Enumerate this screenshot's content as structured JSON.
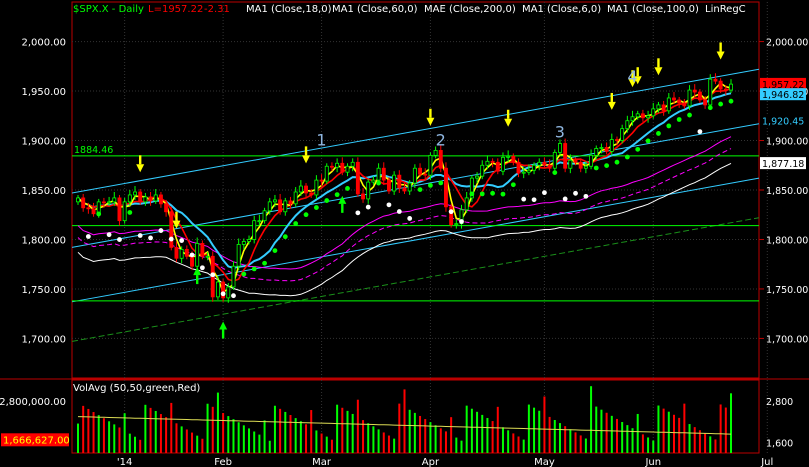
{
  "header": {
    "symbol": "$SPX.X - Daily",
    "last": "L=1957.22",
    "change": "-2.31",
    "studies": [
      "MA1 (Close,18,0)",
      "MA1 (Close,60,0)",
      "MAE (Close,200,0)",
      "MA1 (Close,6,0)",
      "MA1 (Close,100,0)",
      "LinRegC"
    ]
  },
  "colors": {
    "up": "#00ff00",
    "down": "#ff0000",
    "ma6": "#ffff00",
    "ma18": "#ff0000",
    "ma60": "#33ccff",
    "ma100": "#ff00ff",
    "mae200": "#ffffff",
    "channel": "#33ccff",
    "support": "#00ff00",
    "arrow_down": "#ffff00",
    "arrow_up": "#00ff00"
  },
  "chart_data": [
    {
      "type": "candlestick",
      "ylim": [
        1660,
        2040
      ],
      "y_ticks": [
        {
          "value": 2000,
          "label": "2,000.00"
        },
        {
          "value": 1950,
          "label": "1,950.00"
        },
        {
          "value": 1900,
          "label": "1,900.00"
        },
        {
          "value": 1850,
          "label": "1,850.00"
        },
        {
          "value": 1800,
          "label": "1,800.00"
        },
        {
          "value": 1750,
          "label": "1,750.00"
        },
        {
          "value": 1700,
          "label": "1,700.00"
        }
      ],
      "x_ticks": [
        "'14",
        "Feb",
        "Mar",
        "Apr",
        "May",
        "Jun",
        "Jul"
      ],
      "x_tick_index": [
        9,
        28,
        47,
        68,
        90,
        111,
        133
      ],
      "close": [
        1842,
        1832,
        1831,
        1826,
        1838,
        1837,
        1838,
        1842,
        1819,
        1838,
        1845,
        1848,
        1838,
        1843,
        1839,
        1845,
        1836,
        1828,
        1792,
        1781,
        1790,
        1783,
        1773,
        1796,
        1783,
        1783,
        1742,
        1757,
        1741,
        1752,
        1773,
        1795,
        1798,
        1800,
        1819,
        1819,
        1829,
        1838,
        1840,
        1828,
        1839,
        1836,
        1848,
        1854,
        1847,
        1845,
        1860,
        1859,
        1874,
        1873,
        1877,
        1868,
        1874,
        1878,
        1846,
        1841,
        1858,
        1860,
        1872,
        1860,
        1849,
        1865,
        1852,
        1849,
        1857,
        1872,
        1866,
        1865,
        1885,
        1890,
        1872,
        1833,
        1815,
        1816,
        1830,
        1842,
        1862,
        1864,
        1875,
        1879,
        1878,
        1869,
        1883,
        1884,
        1878,
        1867,
        1868,
        1870,
        1875,
        1878,
        1875,
        1872,
        1888,
        1897,
        1872,
        1880,
        1878,
        1872,
        1874,
        1885,
        1892,
        1893,
        1889,
        1901,
        1900,
        1912,
        1920,
        1924,
        1927,
        1923,
        1925,
        1932,
        1936,
        1930,
        1943,
        1941,
        1938,
        1935,
        1951,
        1949,
        1941,
        1936,
        1962,
        1960,
        1952,
        1951,
        1957
      ],
      "volume_bars": 127,
      "overlays": {
        "ma6": "6-period average of close",
        "ma18": "18-period average of close",
        "ma60": "60-period average of close",
        "ma100": "100-period average of close",
        "mae200": "200-period average with envelope"
      },
      "horizontal_lines": [
        {
          "value": 1884.46,
          "label": "1884.46"
        },
        {
          "value": 1814,
          "label": ""
        },
        {
          "value": 1738,
          "label": ""
        }
      ],
      "price_tags": [
        {
          "value": 1957.22,
          "label": "1,957.22",
          "bg": "#ff0000",
          "fg": "#000000"
        },
        {
          "value": 1946.82,
          "label": "1,946.82",
          "bg": "#33ccff",
          "fg": "#000000"
        },
        {
          "value": 1920.45,
          "label": "1,920.45",
          "bg": "#000000",
          "fg": "#33ccff"
        },
        {
          "value": 1877.18,
          "label": "1,877.18",
          "bg": "#ffffff",
          "fg": "#000000"
        }
      ],
      "wave_labels": [
        {
          "label": "1",
          "index": 46,
          "value": 1895
        },
        {
          "label": "2",
          "index": 69,
          "value": 1895
        },
        {
          "label": "3",
          "index": 92,
          "value": 1903
        },
        {
          "label": "4",
          "index": 106,
          "value": 1959
        }
      ],
      "down_arrows": [
        12,
        19,
        44,
        68,
        83,
        103,
        107,
        108,
        112,
        124
      ],
      "up_arrows": [
        23,
        28,
        51
      ]
    },
    {
      "type": "bar",
      "title": "VolAvg (50,50,green,Red)",
      "ylim": [
        1300000,
        3350000
      ],
      "y_ticks": [
        {
          "value": 2800000,
          "label": "2,800,000.00",
          "right_label": "2,800"
        },
        {
          "value": 1600000,
          "label": "",
          "right_label": "1,600"
        }
      ],
      "avg_tag": {
        "value": 1666627,
        "label": "1,666,627.00"
      }
    }
  ]
}
